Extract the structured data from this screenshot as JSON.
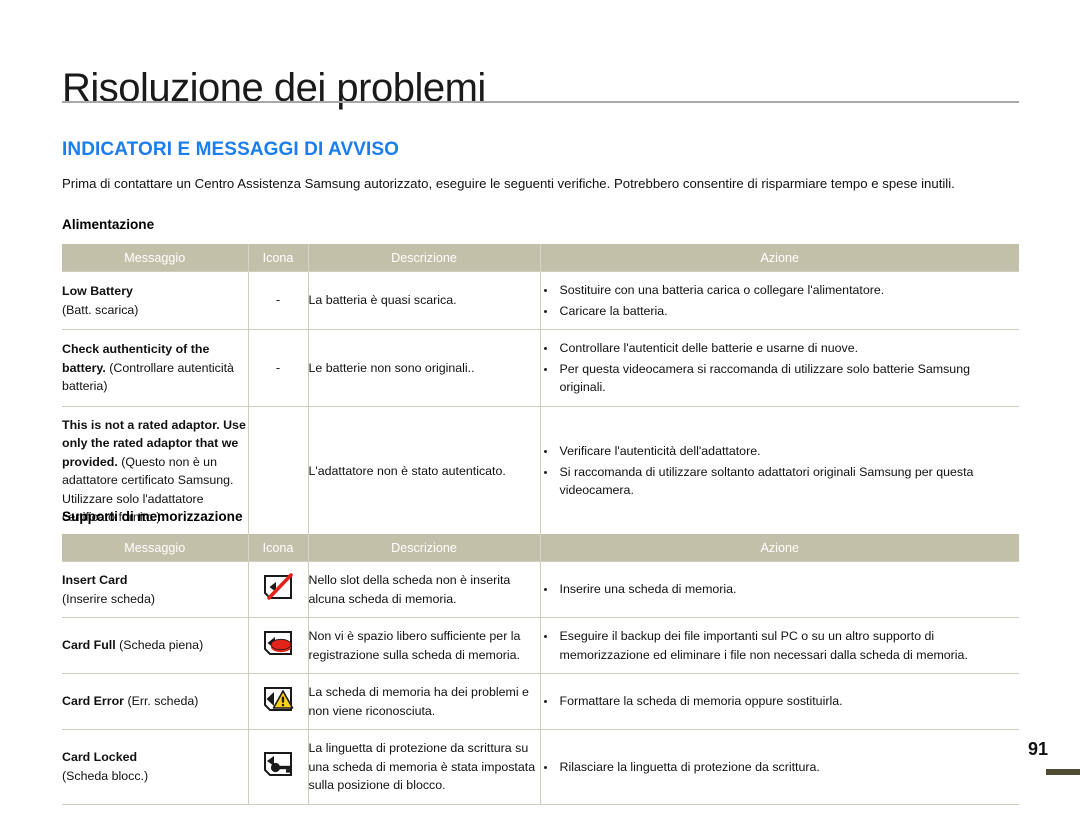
{
  "document": {
    "title": "Risoluzione dei problemi",
    "section_title": "INDICATORI E MESSAGGI DI AVVISO",
    "intro": "Prima di contattare un Centro Assistenza Samsung autorizzato, eseguire le seguenti verifiche. Potrebbero consentire di risparmiare tempo e spese inutili.",
    "page_number": "91",
    "accent_color": "#1a7df0",
    "table_header_color": "#c3c0aa",
    "footer_tab_color": "#4f4b33"
  },
  "columns": {
    "message": "Messaggio",
    "icon": "Icona",
    "description": "Descrizione",
    "action": "Azione"
  },
  "sections": [
    {
      "heading": "Alimentazione",
      "rows": [
        {
          "message_en": "Low Battery",
          "message_it": "(Batt. scarica)",
          "icon": "dash",
          "icon_text": "-",
          "description": "La batteria è quasi scarica.",
          "actions": [
            "Sostituire con una batteria carica o collegare l'alimentatore.",
            "Caricare la batteria."
          ]
        },
        {
          "message_en": "Check authenticity of the battery.",
          "message_it": "(Controllare autenticità batteria)",
          "icon": "dash",
          "icon_text": "-",
          "description": "Le batterie non sono originali..",
          "actions": [
            "Controllare l'autenticit  delle batterie e usarne di nuove.",
            "Per questa videocamera si raccomanda di utilizzare solo batterie Samsung originali."
          ]
        },
        {
          "message_en": "This is not a rated adaptor. Use only the rated adaptor that we provided.",
          "message_it": "(Questo non è un adattatore certificato Samsung. Utilizzare solo l'adattatore certificato fornito.)",
          "icon": "none",
          "icon_text": "",
          "description": "L'adattatore non è stato autenticato.",
          "actions": [
            "Verificare l'autenticità dell'adattatore.",
            "Si raccomanda di utilizzare soltanto adattatori originali Samsung per questa videocamera."
          ]
        }
      ]
    },
    {
      "heading": "Supporti di memorizzazione",
      "rows": [
        {
          "message_en": "Insert Card",
          "message_it": "(Inserire scheda)",
          "icon": "insert-card-icon",
          "icon_text": "",
          "description": "Nello slot della scheda non è inserita alcuna scheda di memoria.",
          "actions": [
            "Inserire una scheda di memoria."
          ]
        },
        {
          "message_en": "Card Full",
          "message_it": "(Scheda piena)",
          "message_inline": true,
          "icon": "card-full-icon",
          "icon_text": "",
          "description": "Non vi è spazio libero sufficiente per la registrazione sulla scheda di memoria.",
          "actions": [
            "Eseguire il backup dei file importanti sul PC o su un altro supporto di memorizzazione ed eliminare i file non necessari dalla scheda di memoria."
          ]
        },
        {
          "message_en": "Card Error",
          "message_it": "(Err. scheda)",
          "message_inline": true,
          "icon": "card-error-icon",
          "icon_text": "",
          "description": "La scheda di memoria ha dei problemi e non viene riconosciuta.",
          "actions": [
            "Formattare la scheda di memoria oppure sostituirla."
          ]
        },
        {
          "message_en": "Card Locked",
          "message_it": "(Scheda blocc.)",
          "icon": "card-locked-icon",
          "icon_text": "",
          "description": "La linguetta di protezione da scrittura su una scheda di memoria è stata impostata sulla posizione di blocco.",
          "actions": [
            "Rilasciare la linguetta di protezione da scrittura."
          ]
        }
      ]
    }
  ]
}
